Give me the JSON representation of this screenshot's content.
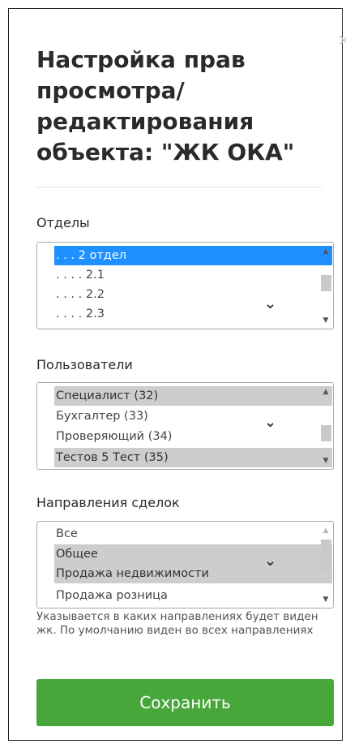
{
  "dialog": {
    "title": "Настройка прав просмотра/ редактирования объекта: \"ЖК ОКА\"",
    "close_icon": "×"
  },
  "departments": {
    "label": "Отделы",
    "options": [
      ". . . 2 отдел",
      ". . . . 2.1",
      ". . . . 2.2",
      ". . . . 2.3"
    ]
  },
  "users": {
    "label": "Пользователи",
    "options": [
      "Специалист (32)",
      "Бухгалтер (33)",
      "Проверяющий (34)",
      "Тестов 5 Тест (35)"
    ]
  },
  "deal_directions": {
    "label": "Направления сделок",
    "options": [
      "Все",
      "Общее",
      "Продажа недвижимости",
      "Продажа розница"
    ],
    "hint": "Указывается в каких направлениях будет виден жк. По умолчанию виден во всех направлениях"
  },
  "save_button": {
    "label": "Сохранить"
  },
  "icons": {
    "scroll_up": "▲",
    "scroll_down": "▼",
    "chevron": "⌄"
  },
  "colors": {
    "active_option": "#1e90ff",
    "selected_option": "#cdcdcd",
    "save_button": "#48a73a"
  }
}
